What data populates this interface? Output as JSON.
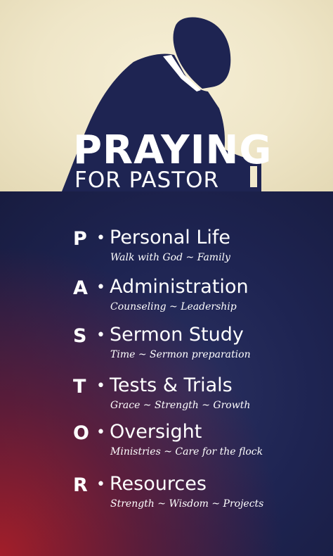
{
  "poster": {
    "title_line1": "PRAYING",
    "title_line2": "FOR PASTOR",
    "silhouette": "kneeling-man-praying-silhouette",
    "colors": {
      "cream": "#f1e9cc",
      "navy": "#1e2452",
      "red": "#a81e2a",
      "silhouette": "#1e2452",
      "text": "#ffffff"
    }
  },
  "items": [
    {
      "letter": "P",
      "heading": "Personal Life",
      "sub": "Walk with God ~ Family"
    },
    {
      "letter": "A",
      "heading": "Administration",
      "sub": "Counseling ~ Leadership"
    },
    {
      "letter": "S",
      "heading": "Sermon Study",
      "sub": "Time ~ Sermon preparation"
    },
    {
      "letter": "T",
      "heading": "Tests & Trials",
      "sub": "Grace ~ Strength ~ Growth"
    },
    {
      "letter": "O",
      "heading": "Oversight",
      "sub": "Ministries ~ Care for the flock"
    },
    {
      "letter": "R",
      "heading": "Resources",
      "sub": "Strength ~ Wisdom ~ Projects"
    }
  ]
}
